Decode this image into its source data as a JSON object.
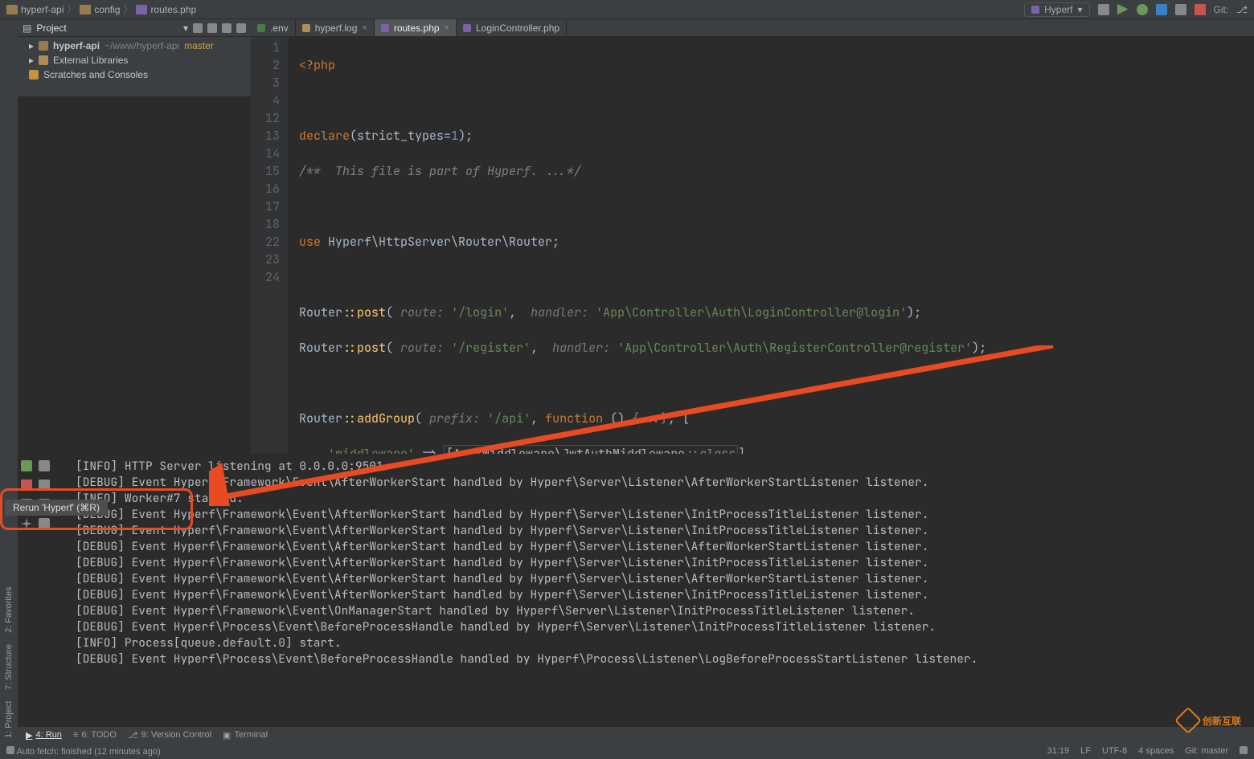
{
  "breadcrumb": {
    "seg0": "hyperf-api",
    "seg1": "config",
    "seg2": "routes.php"
  },
  "run_config": {
    "name": "Hyperf"
  },
  "git_label": "Git:",
  "project": {
    "title": "Project",
    "root_name": "hyperf-api",
    "root_path": "~/www/hyperf-api",
    "root_branch": "master",
    "ext_lib": "External Libraries",
    "scratches": "Scratches and Consoles"
  },
  "leftrail": {
    "project": "1: Project",
    "structure": "7: Structure",
    "favorites": "2: Favorites"
  },
  "tabs": [
    {
      "label": ".env",
      "kind": "env"
    },
    {
      "label": "hyperf.log",
      "kind": "log"
    },
    {
      "label": "routes.php",
      "kind": "php",
      "active": true
    },
    {
      "label": "LoginController.php",
      "kind": "php"
    }
  ],
  "code": {
    "lines": [
      "1",
      "2",
      "3",
      "4",
      "12",
      "13",
      "14",
      "15",
      "16",
      "17",
      "18",
      "22",
      "23",
      "24"
    ],
    "l1a": "<?php",
    "l3_kw": "declare",
    "l3_arg": "strict_types",
    "l3_num": "1",
    "l4": "/**  This file is part of Hyperf. ...*/",
    "l13_use": "use ",
    "l13_ns": "Hyperf\\HttpServer\\Router\\Router;",
    "l15_pre": "Router",
    "l15_fn": "::post",
    "l15_h1": "route:",
    "l15_s1": "'/login'",
    "l15_h2": "handler:",
    "l15_s2": "'App\\Controller\\Auth\\LoginController@login'",
    "l16_s1": "'/register'",
    "l16_s2": "'App\\Controller\\Auth\\RegisterController@register'",
    "l18_fn": "::addGroup",
    "l18_h": "prefix:",
    "l18_s": "'/api'",
    "l18_func": "function",
    "l18_dots": "{...}",
    "l22_k": "'middleware'",
    "l22_arrow": " => ",
    "l22_ns": "[App\\Middleware\\JwtAuthMiddleware",
    "l22_cls": "::class",
    "l22_end": "]",
    "l23": "]);"
  },
  "tooltip": "Rerun 'Hyperf' (⌘R)",
  "console_lines": [
    "[INFO] HTTP Server listening at 0.0.0.0:9501",
    "[DEBUG] Event Hyperf\\Framework\\Event\\AfterWorkerStart handled by Hyperf\\Server\\Listener\\AfterWorkerStartListener listener.",
    "[INFO] Worker#7 started.",
    "[DEBUG] Event Hyperf\\Framework\\Event\\AfterWorkerStart handled by Hyperf\\Server\\Listener\\InitProcessTitleListener listener.",
    "[DEBUG] Event Hyperf\\Framework\\Event\\AfterWorkerStart handled by Hyperf\\Server\\Listener\\InitProcessTitleListener listener.",
    "[DEBUG] Event Hyperf\\Framework\\Event\\AfterWorkerStart handled by Hyperf\\Server\\Listener\\AfterWorkerStartListener listener.",
    "[DEBUG] Event Hyperf\\Framework\\Event\\AfterWorkerStart handled by Hyperf\\Server\\Listener\\InitProcessTitleListener listener.",
    "[DEBUG] Event Hyperf\\Framework\\Event\\AfterWorkerStart handled by Hyperf\\Server\\Listener\\AfterWorkerStartListener listener.",
    "[DEBUG] Event Hyperf\\Framework\\Event\\AfterWorkerStart handled by Hyperf\\Server\\Listener\\InitProcessTitleListener listener.",
    "[DEBUG] Event Hyperf\\Framework\\Event\\OnManagerStart handled by Hyperf\\Server\\Listener\\InitProcessTitleListener listener.",
    "[DEBUG] Event Hyperf\\Process\\Event\\BeforeProcessHandle handled by Hyperf\\Server\\Listener\\InitProcessTitleListener listener.",
    "[INFO] Process[queue.default.0] start.",
    "[DEBUG] Event Hyperf\\Process\\Event\\BeforeProcessHandle handled by Hyperf\\Process\\Listener\\LogBeforeProcessStartListener listener."
  ],
  "bottom_tabs": {
    "run": "4: Run",
    "todo": "6: TODO",
    "vcs": "9: Version Control",
    "terminal": "Terminal"
  },
  "status": {
    "left": "Auto fetch: finished (12 minutes ago)",
    "caret": "31:19",
    "le": "LF",
    "enc": "UTF-8",
    "indent": "4 spaces",
    "git": "Git: master"
  },
  "watermark": "创新互联"
}
